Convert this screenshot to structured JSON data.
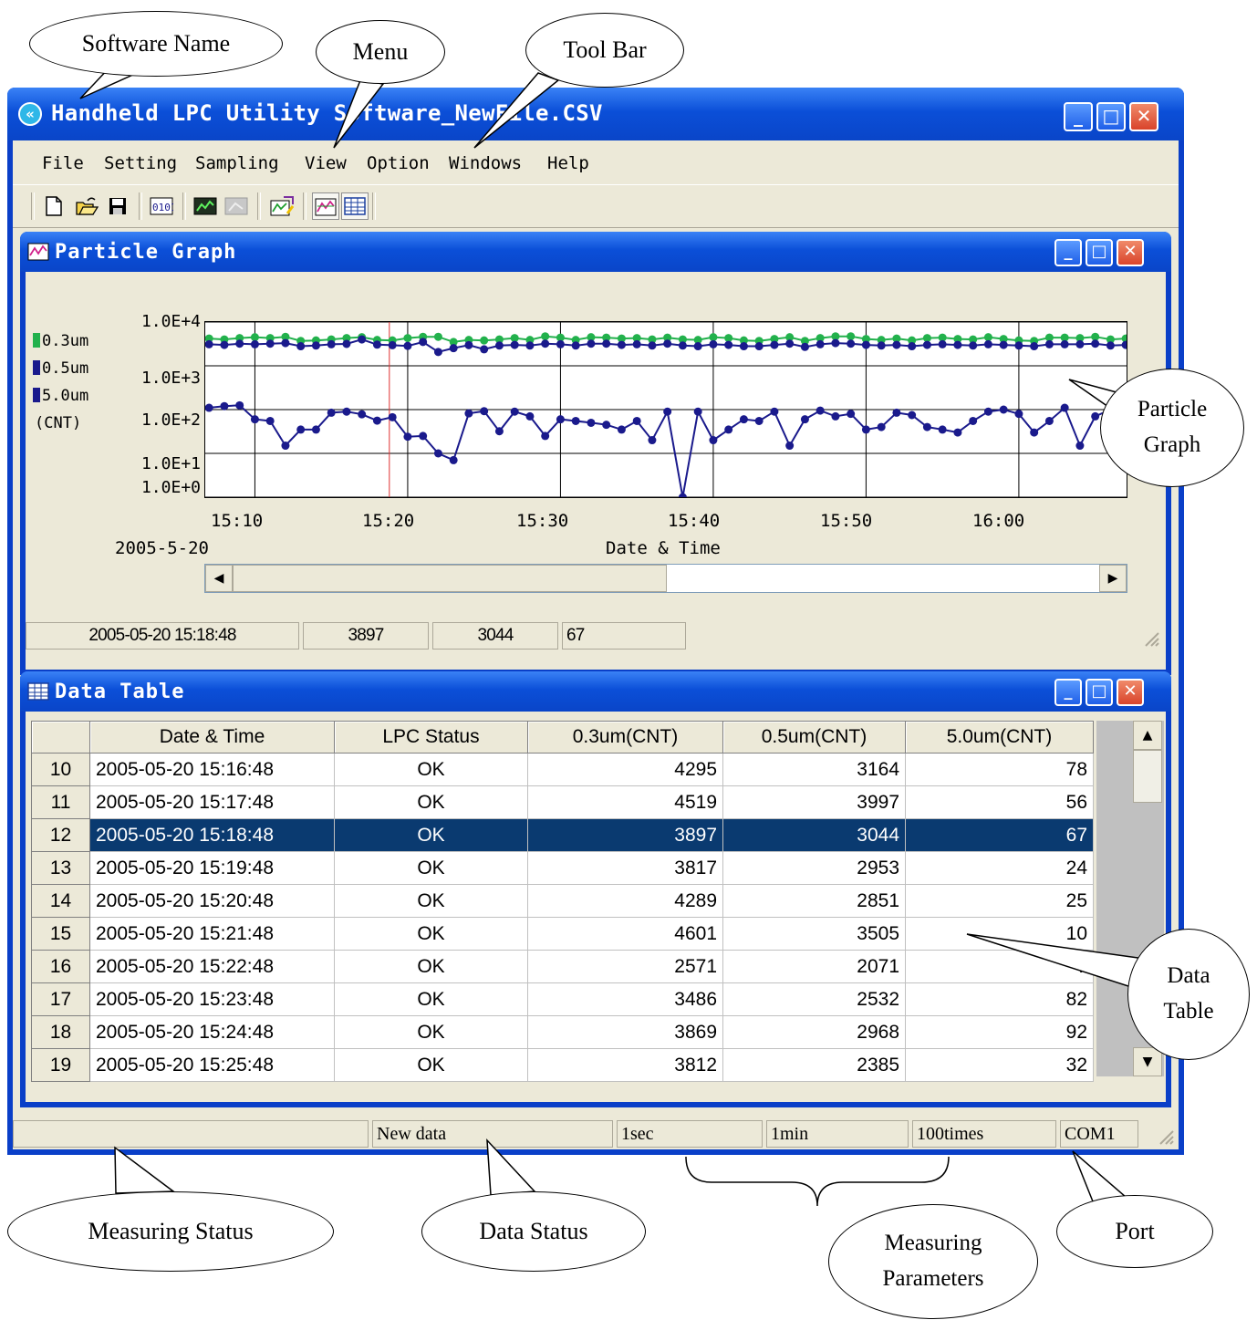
{
  "window": {
    "title": "Handheld LPC Utility Software_NewFile.CSV",
    "minimize": "_",
    "maximize": "□",
    "close": "✕"
  },
  "menu": [
    "File",
    "Setting",
    "Sampling",
    "View",
    "Option",
    "Windows",
    "Help"
  ],
  "toolbar": [
    "new-icon",
    "open-icon",
    "save-icon",
    "binary-icon",
    "graph-icon",
    "graph-disabled-icon",
    "settings-chart-icon",
    "particle-graph-icon",
    "data-table-icon"
  ],
  "graph_window": {
    "title": "Particle Graph",
    "legend": {
      "s1": "0.3um",
      "s2": "0.5um",
      "s3": "5.0um",
      "unit": "(CNT)"
    },
    "date": "2005-5-20",
    "status": {
      "time": "2005-05-20 15:18:48",
      "v1": "3897",
      "v2": "3044",
      "v3": "67"
    }
  },
  "chart_data": {
    "type": "line",
    "xlabel": "Date & Time",
    "yscale": "log",
    "ylim": [
      1,
      10000
    ],
    "ytick_labels": [
      "1.0E+4",
      "1.0E+3",
      "1.0E+2",
      "1.0E+1",
      "1.0E+0"
    ],
    "xtick_labels": [
      "15:10",
      "15:20",
      "15:30",
      "15:40",
      "15:50",
      "16:00"
    ],
    "cursor": "15:18:48",
    "x": [
      "15:07",
      "15:08",
      "15:09",
      "15:10",
      "15:11",
      "15:12",
      "15:13",
      "15:14",
      "15:15",
      "15:16",
      "15:17",
      "15:18",
      "15:19",
      "15:20",
      "15:21",
      "15:22",
      "15:23",
      "15:24",
      "15:25",
      "15:26",
      "15:27",
      "15:28",
      "15:29",
      "15:30",
      "15:31",
      "15:32",
      "15:33",
      "15:34",
      "15:35",
      "15:36",
      "15:37",
      "15:38",
      "15:39",
      "15:40",
      "15:41",
      "15:42",
      "15:43",
      "15:44",
      "15:45",
      "15:46",
      "15:47",
      "15:48",
      "15:49",
      "15:50",
      "15:51",
      "15:52",
      "15:53",
      "15:54",
      "15:55",
      "15:56",
      "15:57",
      "15:58",
      "15:59",
      "16:00",
      "16:01",
      "16:02",
      "16:03",
      "16:04",
      "16:05",
      "16:06",
      "16:07"
    ],
    "series": [
      {
        "name": "0.3um",
        "color": "#22b14c",
        "values": [
          4200,
          4000,
          4300,
          4500,
          4300,
          4600,
          3700,
          3800,
          4000,
          4300,
          4500,
          3900,
          3800,
          4300,
          4600,
          4600,
          3500,
          3900,
          3800,
          4000,
          4300,
          3900,
          4700,
          4400,
          3900,
          4500,
          4400,
          4200,
          4300,
          4000,
          4400,
          4000,
          3900,
          4500,
          4300,
          3800,
          3700,
          4100,
          4500,
          3700,
          4300,
          4700,
          4700,
          4100,
          3900,
          4200,
          3800,
          4300,
          4400,
          4100,
          4000,
          4500,
          4100,
          3800,
          3700,
          4400,
          4400,
          4300,
          4600,
          4000,
          4200
        ]
      },
      {
        "name": "0.5um",
        "color": "#1a1a8c",
        "values": [
          3100,
          3000,
          3200,
          3100,
          3200,
          3300,
          2800,
          2900,
          3100,
          3164,
          3997,
          3044,
          2953,
          2851,
          3505,
          2071,
          2532,
          2968,
          2385,
          2900,
          3000,
          2900,
          3200,
          3100,
          2900,
          3200,
          3200,
          3000,
          3100,
          2900,
          3200,
          2900,
          2800,
          3100,
          3000,
          2800,
          2800,
          3000,
          3200,
          2700,
          3100,
          3300,
          3200,
          3000,
          2900,
          3000,
          2800,
          3000,
          3100,
          3000,
          2900,
          3100,
          3000,
          2900,
          2800,
          3100,
          3100,
          3100,
          3200,
          2900,
          3000
        ]
      },
      {
        "name": "5.0um",
        "color": "#1a1a8c",
        "values": [
          110,
          120,
          125,
          60,
          55,
          15,
          35,
          35,
          85,
          90,
          78,
          56,
          67,
          24,
          25,
          10,
          7,
          82,
          92,
          32,
          90,
          70,
          25,
          60,
          55,
          50,
          45,
          35,
          55,
          20,
          90,
          1,
          90,
          20,
          35,
          60,
          55,
          90,
          15,
          60,
          95,
          70,
          80,
          35,
          40,
          85,
          75,
          40,
          35,
          30,
          55,
          90,
          100,
          80,
          30,
          55,
          110,
          15,
          70,
          100,
          110
        ]
      }
    ]
  },
  "table_window": {
    "title": "Data Table",
    "columns": [
      "Date & Time",
      "LPC Status",
      "0.3um(CNT)",
      "0.5um(CNT)",
      "5.0um(CNT)"
    ],
    "selected_row": "12",
    "rows": [
      [
        "10",
        "2005-05-20 15:16:48",
        "OK",
        "4295",
        "3164",
        "78"
      ],
      [
        "11",
        "2005-05-20 15:17:48",
        "OK",
        "4519",
        "3997",
        "56"
      ],
      [
        "12",
        "2005-05-20 15:18:48",
        "OK",
        "3897",
        "3044",
        "67"
      ],
      [
        "13",
        "2005-05-20 15:19:48",
        "OK",
        "3817",
        "2953",
        "24"
      ],
      [
        "14",
        "2005-05-20 15:20:48",
        "OK",
        "4289",
        "2851",
        "25"
      ],
      [
        "15",
        "2005-05-20 15:21:48",
        "OK",
        "4601",
        "3505",
        "10"
      ],
      [
        "16",
        "2005-05-20 15:22:48",
        "OK",
        "2571",
        "2071",
        "7"
      ],
      [
        "17",
        "2005-05-20 15:23:48",
        "OK",
        "3486",
        "2532",
        "82"
      ],
      [
        "18",
        "2005-05-20 15:24:48",
        "OK",
        "3869",
        "2968",
        "92"
      ],
      [
        "19",
        "2005-05-20 15:25:48",
        "OK",
        "3812",
        "2385",
        "32"
      ]
    ]
  },
  "statusbar": {
    "measuring": "",
    "data_status": "New data",
    "p1": "1sec",
    "p2": "1min",
    "p3": "100times",
    "port": "COM1"
  },
  "callouts": {
    "software_name": "Software Name",
    "menu": "Menu",
    "tool_bar": "Tool Bar",
    "particle_graph": "Particle Graph",
    "data_table": "Data Table",
    "measuring_status": "Measuring Status",
    "data_status": "Data Status",
    "measuring_parameters": "Measuring Parameters",
    "port": "Port"
  }
}
